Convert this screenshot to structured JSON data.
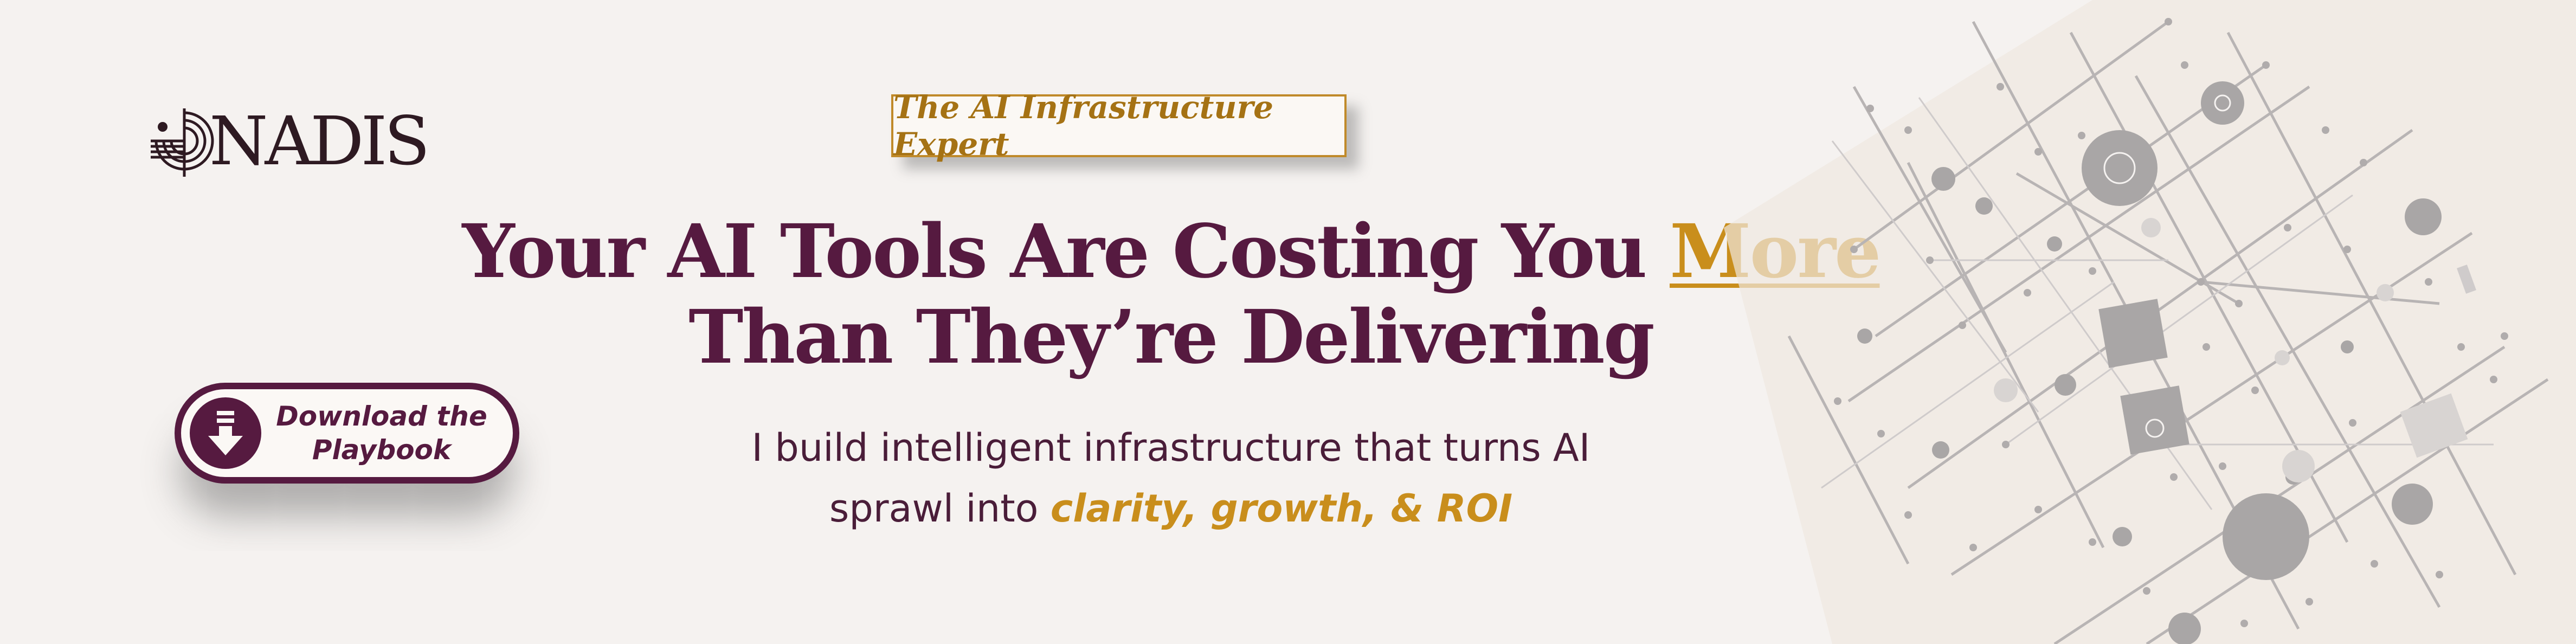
{
  "brand": {
    "name": "NADIS",
    "logo_icon": "nadis-logo-icon"
  },
  "tag": {
    "label": "The AI Infrastructure Expert"
  },
  "headline": {
    "line1_start": "Your AI Tools Are Costing You ",
    "line1_accent": "More ",
    "line2": "Than They’re Delivering"
  },
  "subheadline": {
    "line1": "I build intelligent infrastructure that turns AI",
    "line2_start": "sprawl into ",
    "line2_accent": "clarity, growth, & ROI"
  },
  "cta": {
    "line1": "Download the",
    "line2": "Playbook",
    "icon": "download-arrow-icon"
  },
  "colors": {
    "background": "#f5f2f0",
    "primary": "#561a40",
    "accent": "#c98e1c",
    "tag_text": "#a57214",
    "network_grey": "#a9a6a6"
  }
}
